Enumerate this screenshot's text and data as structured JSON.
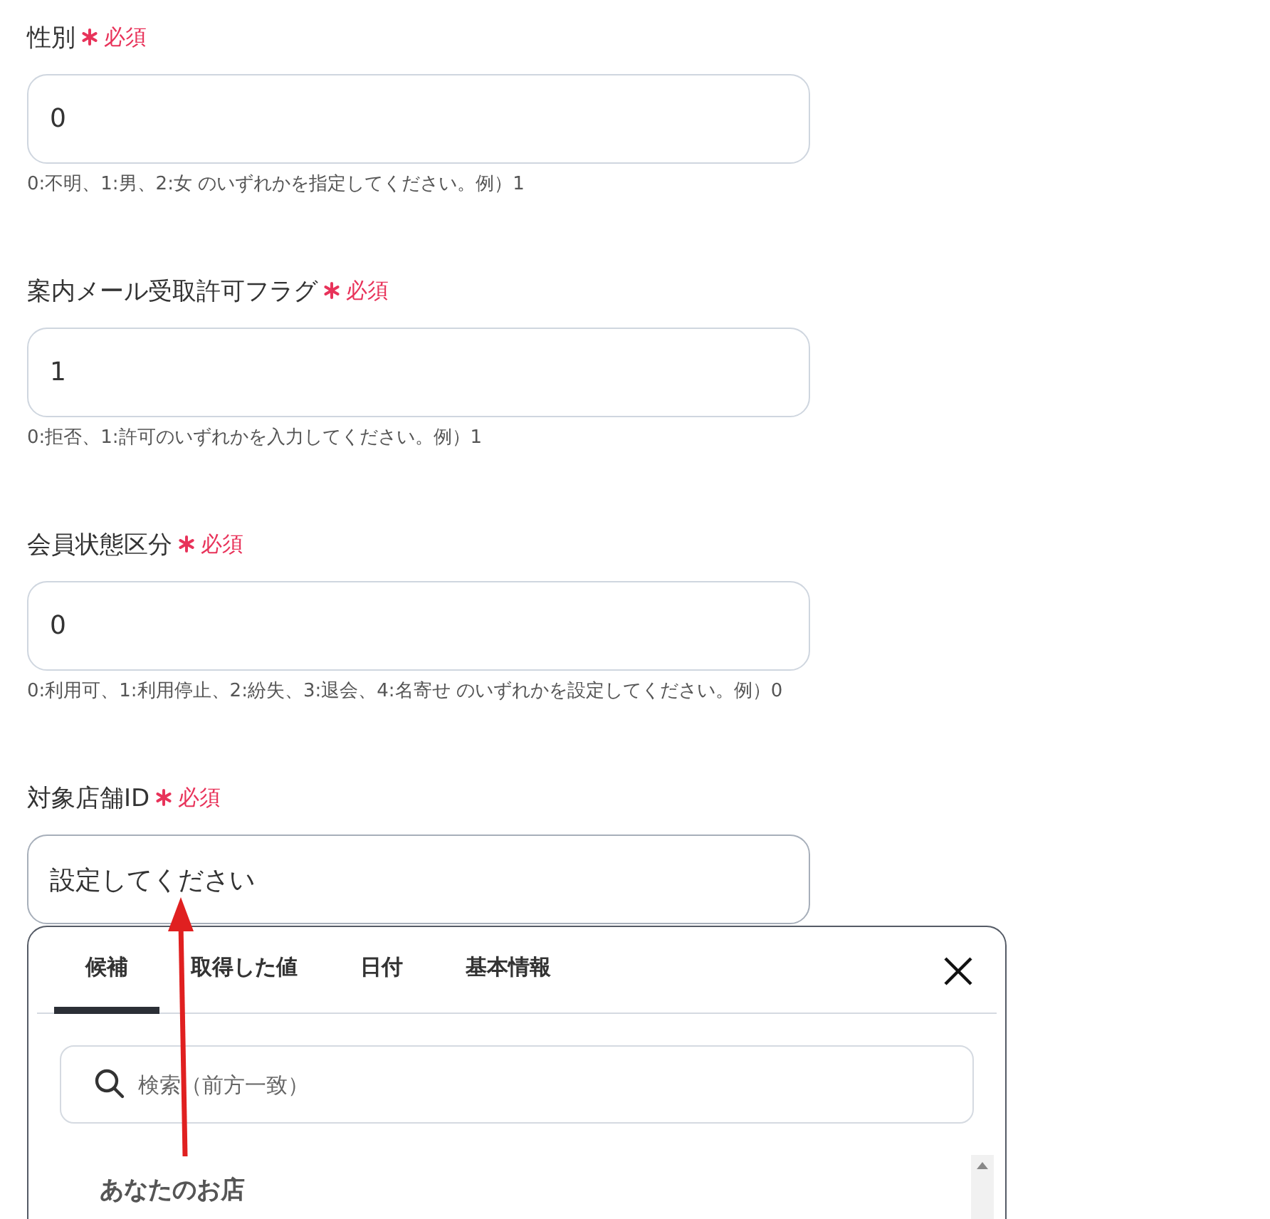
{
  "fields": [
    {
      "label": "性別",
      "required": true,
      "required_text": "必須",
      "value": "0",
      "hint": "0:不明、1:男、2:女 のいずれかを指定してください。例）1"
    },
    {
      "label": "案内メール受取許可フラグ",
      "required": true,
      "required_text": "必須",
      "value": "1",
      "hint": "0:拒否、1:許可のいずれかを入力してください。例）1"
    },
    {
      "label": "会員状態区分",
      "required": true,
      "required_text": "必須",
      "value": "0",
      "hint": "0:利用可、1:利用停止、2:紛失、3:退会、4:名寄せ のいずれかを設定してください。例）0"
    },
    {
      "label": "対象店舗ID",
      "required": true,
      "required_text": "必須",
      "placeholder": "設定してください"
    }
  ],
  "popup": {
    "tabs": [
      {
        "label": "候補",
        "selected": true
      },
      {
        "label": "取得した値",
        "selected": false
      },
      {
        "label": "日付",
        "selected": false
      },
      {
        "label": "基本情報",
        "selected": false
      }
    ],
    "search": {
      "placeholder": "検索（前方一致）"
    },
    "section_title": "あなたのお店"
  }
}
